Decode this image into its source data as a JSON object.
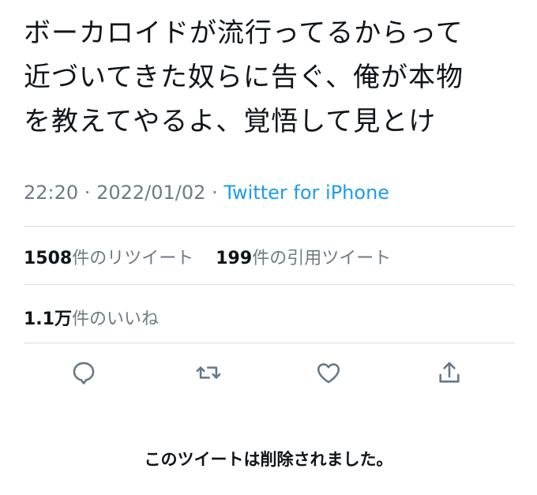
{
  "tweet": {
    "lines": [
      "ボーカロイドが流行ってるからって",
      "近づいてきた奴らに告ぐ、俺が本物",
      "を教えてやるよ、覚悟して見とけ"
    ],
    "time": "22:20",
    "separator": "·",
    "date": "2022/01/02",
    "source": "Twitter for iPhone"
  },
  "stats": {
    "retweets_count": "1508",
    "retweets_label": "件のリツイート",
    "quotes_count": "199",
    "quotes_label": "件の引用ツイート",
    "likes_count": "1.1万",
    "likes_label": "件のいいね"
  },
  "actions": {
    "icons": [
      "reply-icon",
      "retweet-icon",
      "like-icon",
      "share-icon"
    ],
    "icon_color": "#657786"
  },
  "notice": {
    "deleted": "このツイートは削除されました。"
  }
}
